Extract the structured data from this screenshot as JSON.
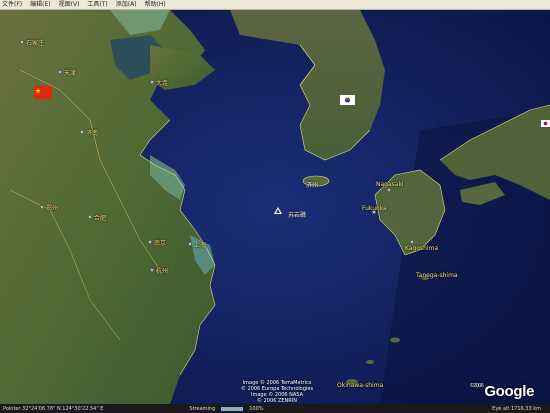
{
  "menu": [
    "文件(F)",
    "编辑(E)",
    "视图(V)",
    "工具(T)",
    "添加(A)",
    "帮助(H)"
  ],
  "labels": {
    "reef": "苏岩礁",
    "nagasaki": "Nagasaki",
    "fukuoka": "Fukuoka",
    "kagoshima": "Kagoshima",
    "tanegashima": "Tanega-shima",
    "okinawa": "Okinawa-shima",
    "hangzhou": "杭州",
    "shanghai": "上海",
    "nanjing": "南京",
    "tianjin": "天津",
    "dalian": "大连",
    "jinan": "济南",
    "shijiazhuang": "石家庄",
    "zhengzhou": "郑州",
    "hefei": "合肥",
    "jeju": "济州"
  },
  "copyright": [
    "Image © 2006 TerraMetrics",
    "© 2006 Europa Technologies",
    "Image © 2006 NASA",
    "© 2006 ZENRIN"
  ],
  "logo": {
    "year": "©2006",
    "text": "Google"
  },
  "status": {
    "pointer": "Pointer  32°24'06.78\" N   124°30'22.54\" E",
    "streaming_label": "Streaming",
    "streaming_percent": "100%",
    "streaming_value": 1.0,
    "eye_alt": "Eye alt   1716.33 km"
  },
  "colors": {
    "sea": "#0f1f5c",
    "land": "#5d6a3a",
    "border": "#f0e070"
  }
}
